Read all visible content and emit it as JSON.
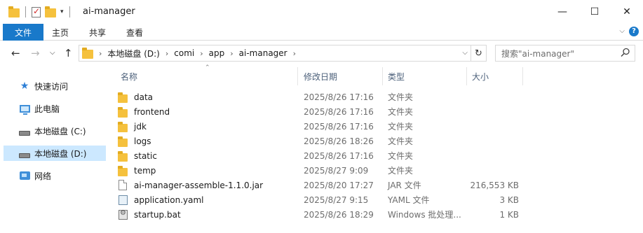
{
  "window": {
    "title": "ai-manager",
    "controls": {
      "minimize": "—",
      "maximize": "☐",
      "close": "✕"
    }
  },
  "ribbon": {
    "file": "文件",
    "tabs": [
      "主页",
      "共享",
      "查看"
    ],
    "collapse": "⌵",
    "help": "?"
  },
  "nav": {
    "back": "←",
    "forward": "→",
    "recent": "⌵",
    "up": "↑",
    "breadcrumb": [
      "本地磁盘 (D:)",
      "comi",
      "app",
      "ai-manager"
    ],
    "refresh": "↻",
    "search_placeholder": "搜索\"ai-manager\""
  },
  "sidebar": {
    "items": [
      {
        "label": "快速访问",
        "icon": "quick-access-icon",
        "selected": false
      },
      {
        "label": "此电脑",
        "icon": "computer-icon",
        "selected": false
      },
      {
        "label": "本地磁盘 (C:)",
        "icon": "drive-icon",
        "selected": false
      },
      {
        "label": "本地磁盘 (D:)",
        "icon": "drive-icon",
        "selected": true
      },
      {
        "label": "网络",
        "icon": "network-icon",
        "selected": false
      }
    ]
  },
  "columns": {
    "name": "名称",
    "date": "修改日期",
    "type": "类型",
    "size": "大小"
  },
  "files": [
    {
      "name": "data",
      "date": "2025/8/26 17:16",
      "type": "文件夹",
      "size": "",
      "icon": "folder-icon"
    },
    {
      "name": "frontend",
      "date": "2025/8/26 17:16",
      "type": "文件夹",
      "size": "",
      "icon": "folder-icon"
    },
    {
      "name": "jdk",
      "date": "2025/8/26 17:16",
      "type": "文件夹",
      "size": "",
      "icon": "folder-icon"
    },
    {
      "name": "logs",
      "date": "2025/8/26 18:26",
      "type": "文件夹",
      "size": "",
      "icon": "folder-icon"
    },
    {
      "name": "static",
      "date": "2025/8/26 17:16",
      "type": "文件夹",
      "size": "",
      "icon": "folder-icon"
    },
    {
      "name": "temp",
      "date": "2025/8/27 9:09",
      "type": "文件夹",
      "size": "",
      "icon": "folder-icon"
    },
    {
      "name": "ai-manager-assemble-1.1.0.jar",
      "date": "2025/8/20 17:27",
      "type": "JAR 文件",
      "size": "216,553 KB",
      "icon": "jar-file-icon"
    },
    {
      "name": "application.yaml",
      "date": "2025/8/27 9:15",
      "type": "YAML 文件",
      "size": "3 KB",
      "icon": "yaml-file-icon"
    },
    {
      "name": "startup.bat",
      "date": "2025/8/26 18:29",
      "type": "Windows 批处理...",
      "size": "1 KB",
      "icon": "bat-file-icon"
    }
  ]
}
